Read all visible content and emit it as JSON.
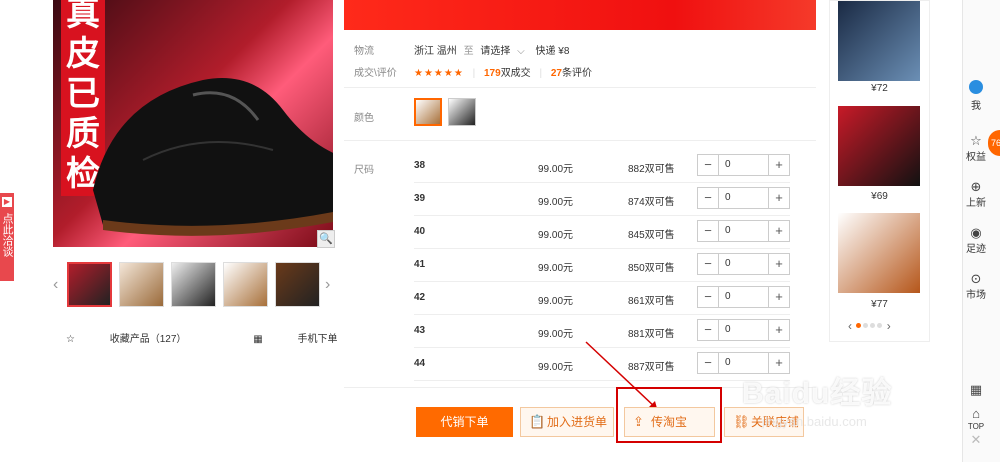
{
  "side_tab": {
    "label": "点此洽谈"
  },
  "main_image": {
    "banner_text": "真皮已质检"
  },
  "favorites": {
    "collect": "收藏产品（127）",
    "mobile_order": "手机下单"
  },
  "info": {
    "logistics_label": "物流",
    "origin": "浙江 温州",
    "to": "至",
    "destination": "请选择",
    "express": "快递 ¥8",
    "deal_label": "成交\\评价",
    "stars": "★★★★★",
    "deals_count": "179",
    "deals_unit": "双成交",
    "reviews_count": "27",
    "reviews_unit": "条评价",
    "color_label": "颜色",
    "size_label": "尺码"
  },
  "sizes": [
    {
      "size": "38",
      "price": "99.00元",
      "stock": "882双可售",
      "qty": "0"
    },
    {
      "size": "39",
      "price": "99.00元",
      "stock": "874双可售",
      "qty": "0"
    },
    {
      "size": "40",
      "price": "99.00元",
      "stock": "845双可售",
      "qty": "0"
    },
    {
      "size": "41",
      "price": "99.00元",
      "stock": "850双可售",
      "qty": "0"
    },
    {
      "size": "42",
      "price": "99.00元",
      "stock": "861双可售",
      "qty": "0"
    },
    {
      "size": "43",
      "price": "99.00元",
      "stock": "881双可售",
      "qty": "0"
    },
    {
      "size": "44",
      "price": "99.00元",
      "stock": "887双可售",
      "qty": "0"
    }
  ],
  "actions": {
    "primary": "代销下单",
    "add_to_list": "加入进货单",
    "to_taobao": "传淘宝",
    "link_shop": "关联店铺"
  },
  "recommend": {
    "prices": [
      "¥72",
      "¥69",
      "¥77"
    ]
  },
  "toolbar": {
    "me": "我",
    "benefits": "权益",
    "new": "上新",
    "footprint": "足迹",
    "market": "市场",
    "top": "TOP",
    "badge": "76"
  },
  "watermark": {
    "brand": "Baidu经验",
    "url": "jingyan.baidu.com"
  },
  "colors": {
    "accent": "#ff6a00",
    "red": "#e4393c",
    "highlight": "#d40000"
  }
}
